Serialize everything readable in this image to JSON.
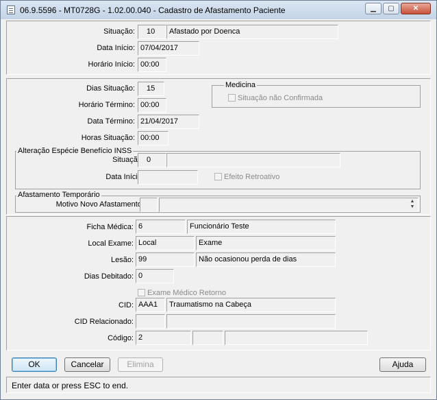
{
  "window": {
    "title": "06.9.5596 - MT0728G - 1.02.00.040 - Cadastro de Afastamento Paciente"
  },
  "controls": {
    "minimize": "▁",
    "maximize": "▢",
    "close": "✕"
  },
  "top": {
    "situacao_label": "Situação:",
    "situacao_code": "10",
    "situacao_desc": "Afastado por Doenca",
    "data_inicio_label": "Data Início:",
    "data_inicio": "07/04/2017",
    "horario_inicio_label": "Horário Início:",
    "horario_inicio": "00:00"
  },
  "middle": {
    "dias_situacao_label": "Dias Situação:",
    "dias_situacao": "15",
    "horario_termino_label": "Horário Término:",
    "horario_termino": "00:00",
    "data_termino_label": "Data Término:",
    "data_termino": "21/04/2017",
    "horas_situacao_label": "Horas Situação:",
    "horas_situacao": "00:00",
    "medicina": {
      "title": "Medicina",
      "situacao_nao_confirmada": "Situação não Confirmada"
    },
    "inss": {
      "title": "Alteração Espécie Benefício INSS",
      "situacao_label": "Situação:",
      "situacao_code": "0",
      "situacao_desc": "",
      "data_inicio_label": "Data Início:",
      "data_inicio": "",
      "efeito_retroativo": "Efeito Retroativo"
    },
    "afastamento": {
      "title": "Afastamento Temporário",
      "motivo_label": "Motivo Novo Afastamento:",
      "motivo_code": "",
      "motivo_desc": ""
    }
  },
  "bottom": {
    "ficha_label": "Ficha Médica:",
    "ficha_code": "6",
    "ficha_desc": "Funcionário Teste",
    "local_label": "Local Exame:",
    "local_code": "Local",
    "local_desc": "Exame",
    "lesao_label": "Lesão:",
    "lesao_code": "99",
    "lesao_desc": "Não ocasionou perda de dias",
    "dias_debitado_label": "Dias Debitado:",
    "dias_debitado": "0",
    "exame_retorno": "Exame Médico Retorno",
    "cid_label": "CID:",
    "cid_code": "AAA1",
    "cid_desc": "Traumatismo na Cabeça",
    "cid_rel_label": "CID Relacionado:",
    "cid_rel_code": "",
    "cid_rel_desc": "",
    "codigo_label": "Código:",
    "codigo_1": "2",
    "codigo_2": "",
    "codigo_3": ""
  },
  "buttons": {
    "ok": "OK",
    "cancelar": "Cancelar",
    "elimina": "Elimina",
    "ajuda": "Ajuda"
  },
  "status": "Enter data or press ESC to end."
}
